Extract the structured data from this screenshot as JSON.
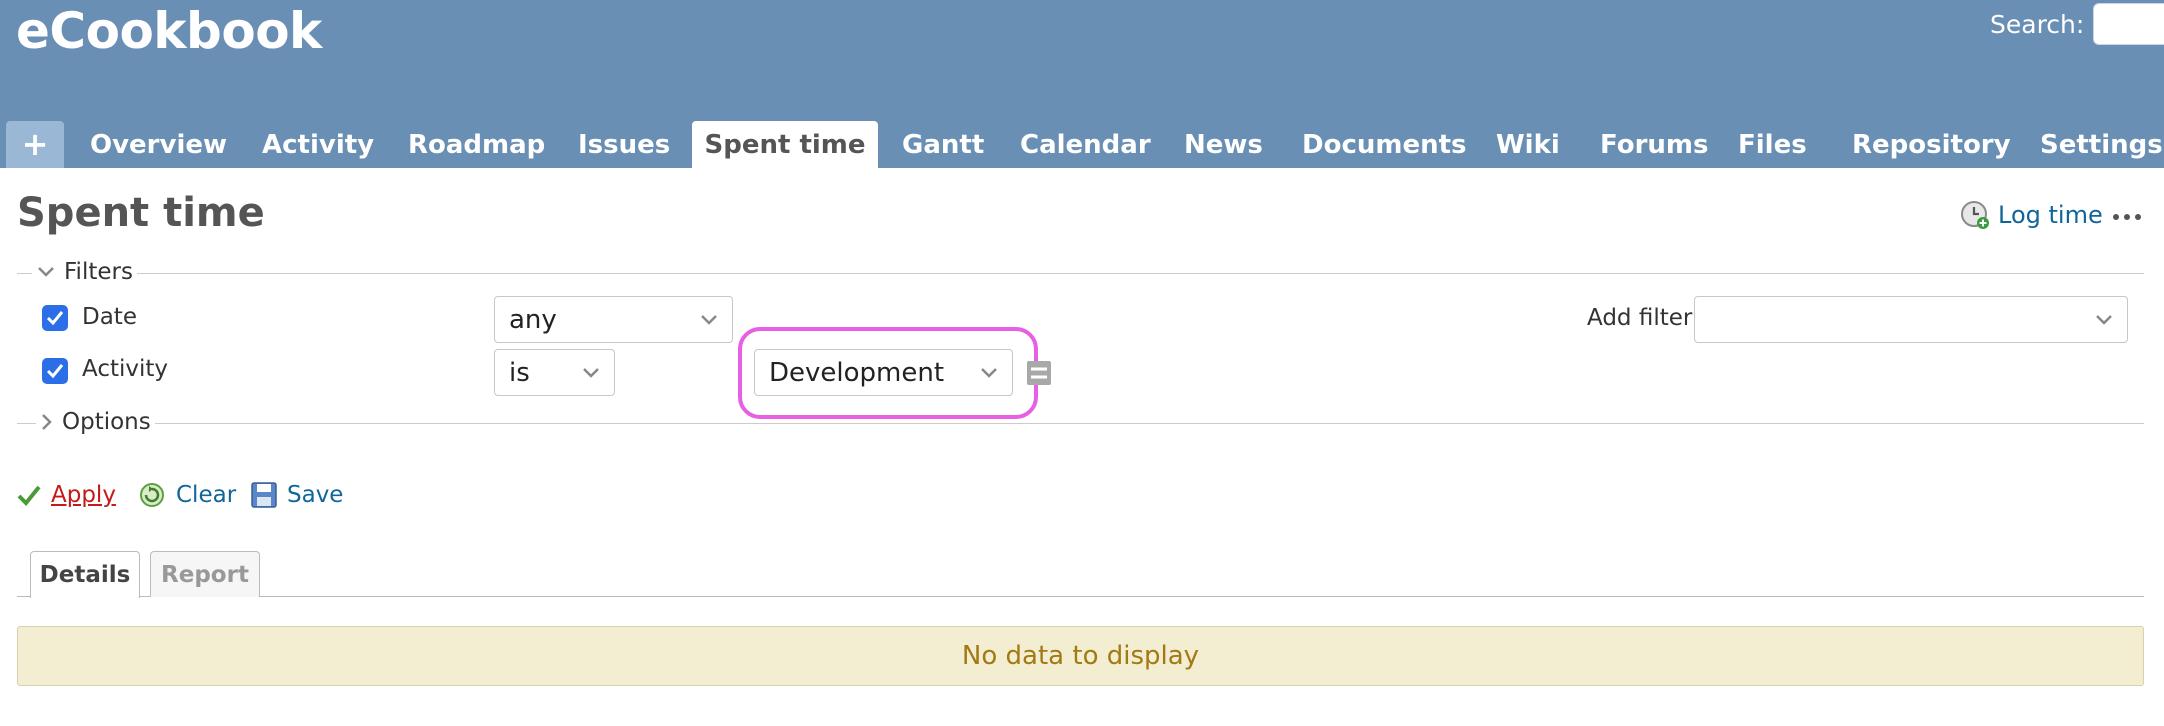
{
  "header": {
    "app_title": "eCookbook",
    "search_label": "Search:",
    "search_value": ""
  },
  "menu": {
    "plus_label": "+",
    "items": [
      {
        "label": "Overview"
      },
      {
        "label": "Activity"
      },
      {
        "label": "Roadmap"
      },
      {
        "label": "Issues"
      },
      {
        "label": "Spent time",
        "selected": true
      },
      {
        "label": "Gantt"
      },
      {
        "label": "Calendar"
      },
      {
        "label": "News"
      },
      {
        "label": "Documents"
      },
      {
        "label": "Wiki"
      },
      {
        "label": "Forums"
      },
      {
        "label": "Files"
      },
      {
        "label": "Repository"
      },
      {
        "label": "Settings"
      }
    ]
  },
  "content": {
    "page_title": "Spent time",
    "log_time_label": "Log time",
    "filters": {
      "legend": "Filters",
      "rows": [
        {
          "label": "Date",
          "checked": true,
          "operator": "any"
        },
        {
          "label": "Activity",
          "checked": true,
          "operator": "is",
          "value": "Development"
        }
      ],
      "add_filter_label": "Add filter",
      "add_filter_value": ""
    },
    "options_legend": "Options",
    "actions": {
      "apply": "Apply",
      "clear": "Clear",
      "save": "Save"
    },
    "tabs": [
      {
        "label": "Details",
        "selected": true
      },
      {
        "label": "Report",
        "selected": false
      }
    ],
    "nodata": "No data to display"
  },
  "colors": {
    "header_bg": "#6a8fb5",
    "link": "#116699",
    "highlight": "#e75fe2",
    "nodata_bg": "#f3edd1"
  }
}
